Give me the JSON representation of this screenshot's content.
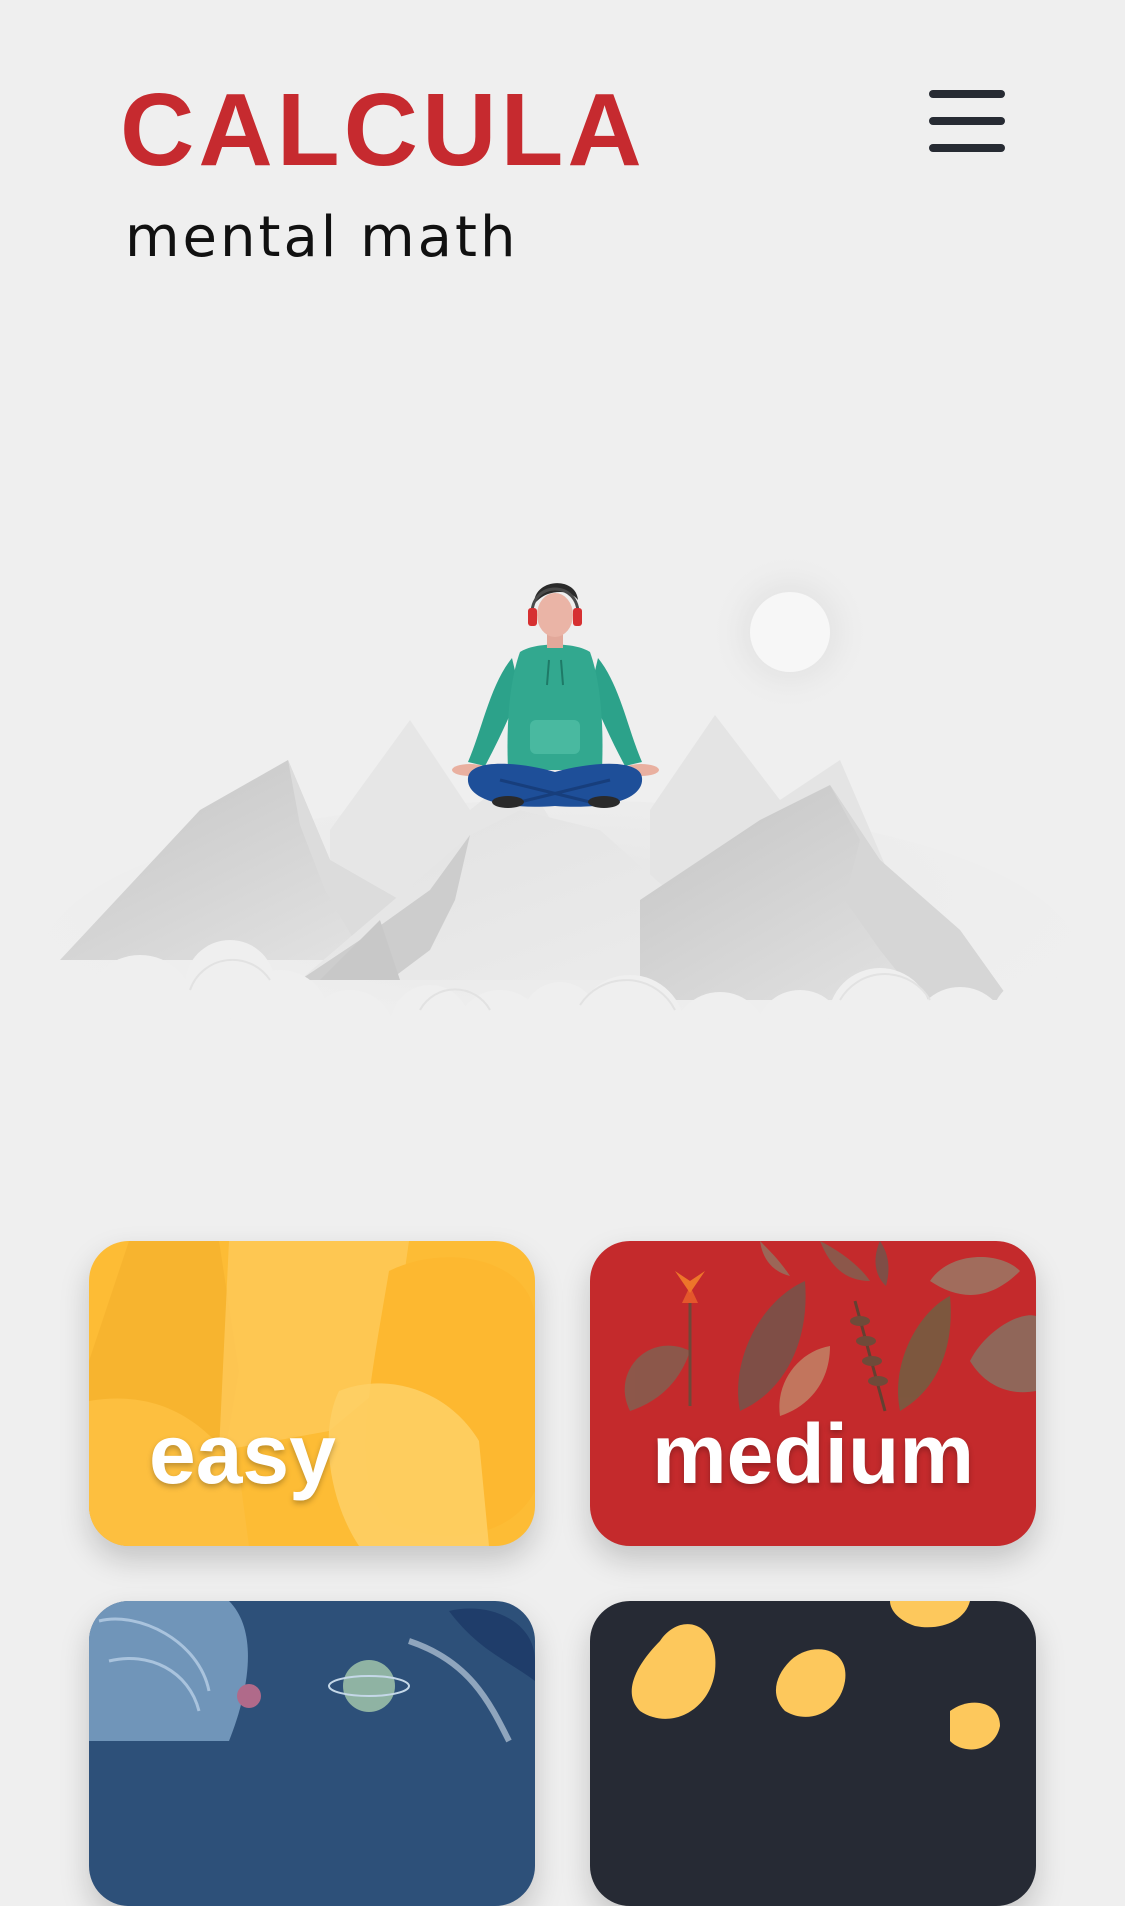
{
  "header": {
    "title": "CALCULA",
    "subtitle": "mental math",
    "menu_icon": "hamburger-menu-icon"
  },
  "colors": {
    "brand": "#c62a2f",
    "background": "#efefef",
    "easy": "#fdbc35",
    "medium": "#c42a2c",
    "hard": "#2d5079",
    "expert": "#262a34"
  },
  "hero": {
    "illustration": "meditating-person-on-mountains-illustration"
  },
  "levels": [
    {
      "label": "easy"
    },
    {
      "label": "medium"
    },
    {
      "label": ""
    },
    {
      "label": ""
    }
  ]
}
